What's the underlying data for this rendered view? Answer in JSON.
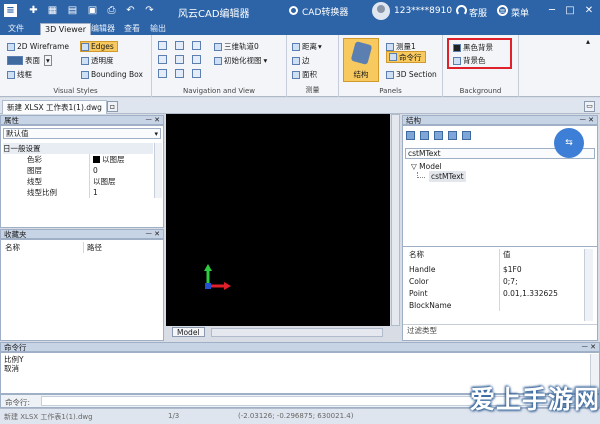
{
  "window": {
    "title": "风云CAD编辑器",
    "cad_converter": "CAD转换器",
    "user_id": "123****8910",
    "service": "客服",
    "menu": "菜单"
  },
  "tabs": [
    "文件",
    "3D Viewer",
    "编辑器",
    "查看",
    "输出"
  ],
  "ribbon": {
    "visual_styles": {
      "label": "Visual Styles",
      "wireframe": "2D Wireframe",
      "surface": "表面",
      "lines": "线框",
      "edges": "Edges",
      "transparency": "透明度",
      "bounding_box": "Bounding Box"
    },
    "navigation": {
      "label": "Navigation and View",
      "orbit": "三维轨道0",
      "init_view": "初始化视图"
    },
    "measure": {
      "label": "测量",
      "distance": "距离",
      "edge": "边",
      "area": "面积"
    },
    "panels": {
      "label": "Panels",
      "structure": "结构",
      "measure1": "测量1",
      "command_line": "命令行",
      "section_3d": "3D Section"
    },
    "background": {
      "label": "Background",
      "black_bg": "黑色背景",
      "bg_color": "背景色"
    }
  },
  "doc_tab": "新建 XLSX 工作表1(1).dwg",
  "properties": {
    "title": "属性",
    "pin": "ᅳ ✕",
    "selector": "默认值",
    "section": "日一般设置",
    "rows": [
      {
        "name": "色彩",
        "value": "以图层"
      },
      {
        "name": "图层",
        "value": "0"
      },
      {
        "name": "线型",
        "value": "以图层"
      },
      {
        "name": "线型比例",
        "value": "1"
      }
    ]
  },
  "favorites": {
    "title": "收藏夹",
    "pin": "ᅳ ✕",
    "col_name": "名称",
    "col_path": "路径"
  },
  "viewport": {
    "tab": "Model"
  },
  "structure": {
    "title": "结构",
    "pin": "ᅳ ✕",
    "selector": "cstMText",
    "tree_root": "Model",
    "tree_child": "cstMText",
    "col_name": "名称",
    "col_value": "值",
    "props": [
      {
        "name": "Handle",
        "value": "$1F0"
      },
      {
        "name": "Color",
        "value": "0;7;"
      },
      {
        "name": "Point",
        "value": "0.01,1.332625"
      },
      {
        "name": "BlockName",
        "value": ""
      }
    ],
    "filter": "过滤类型"
  },
  "command": {
    "title": "命令行",
    "pin": "ᅳ ✕",
    "lines": [
      "比例Y",
      "取消"
    ],
    "prompt": "命令行:"
  },
  "status": {
    "file": "新建 XLSX 工作表1(1).dwg",
    "page": "1/3",
    "coords": "(-2.03126; -0.296875; 630021.4)"
  },
  "watermark": "爱上手游网",
  "colors": {
    "titlebar": "#2d64a8",
    "highlight_box": "#e0202a",
    "active_button": "#f7c95e"
  }
}
